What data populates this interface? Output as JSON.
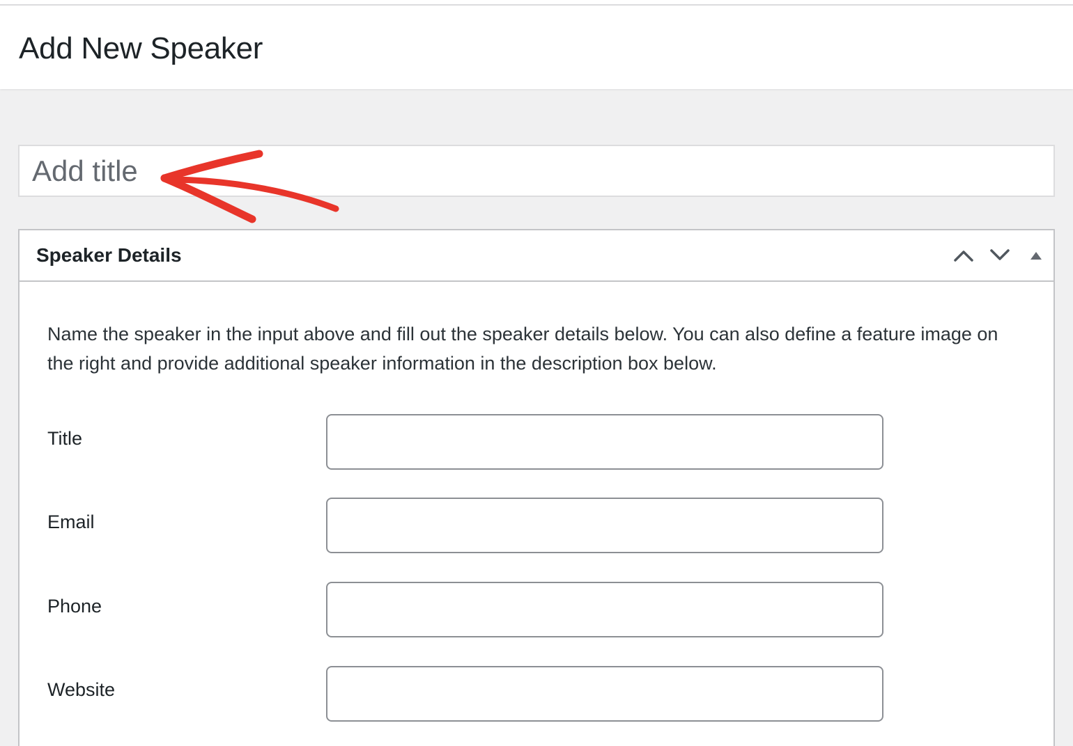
{
  "header": {
    "title": "Add New Speaker"
  },
  "title_input": {
    "placeholder": "Add title",
    "value": ""
  },
  "annotation": {
    "arrow_color": "#e8352a"
  },
  "metabox": {
    "title": "Speaker Details",
    "controls": [
      "chevron-up-icon",
      "chevron-down-icon",
      "triangle-up-icon"
    ],
    "description": "Name the speaker in the input above and fill out the speaker details below. You can also define a feature image on the right and provide additional speaker information in the description box below.",
    "fields": [
      {
        "label": "Title",
        "value": ""
      },
      {
        "label": "Email",
        "value": ""
      },
      {
        "label": "Phone",
        "value": ""
      },
      {
        "label": "Website",
        "value": ""
      }
    ]
  },
  "colors": {
    "background": "#f0f0f1",
    "panel": "#ffffff",
    "border": "#c3c4c7",
    "text": "#1d2327"
  }
}
